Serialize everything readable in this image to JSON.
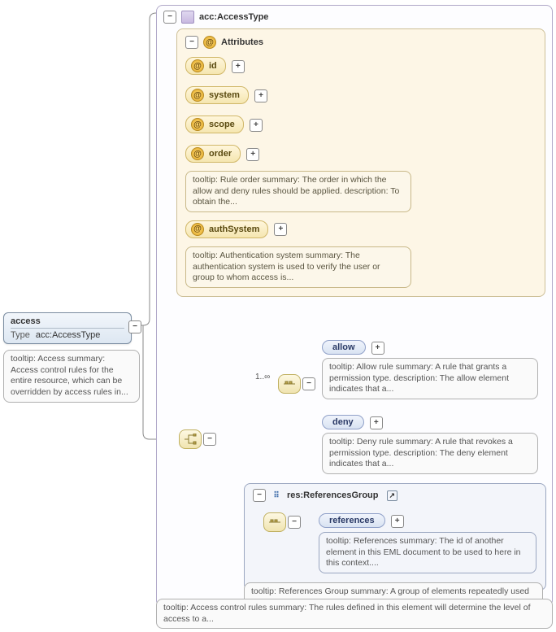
{
  "root": {
    "name": "access",
    "type_label": "Type",
    "type_value": "acc:AccessType",
    "tooltip": "tooltip: Access summary: Access control rules for the entire resource, which can be overridden by access rules in..."
  },
  "panel": {
    "title": "acc:AccessType",
    "tooltip": "tooltip: Access control rules summary: The rules defined in this element will determine the level of access to a..."
  },
  "attrs": {
    "header": "Attributes",
    "items": [
      {
        "name": "id"
      },
      {
        "name": "system"
      },
      {
        "name": "scope"
      },
      {
        "name": "order",
        "tooltip": "tooltip: Rule order summary: The order in which the allow and deny rules should be applied. description: To obtain the..."
      },
      {
        "name": "authSystem",
        "tooltip": "tooltip: Authentication system summary: The authentication system is used to verify the user or group to whom access is..."
      }
    ]
  },
  "choice": {
    "occ": "1..∞",
    "allow": {
      "label": "allow",
      "tooltip": "tooltip: Allow rule summary: A rule that grants a permission type. description: The allow element indicates that a..."
    },
    "deny": {
      "label": "deny",
      "tooltip": "tooltip: Deny rule summary: A rule that revokes a permission type. description: The deny element indicates that a..."
    }
  },
  "refgroup": {
    "title": "res:ReferencesGroup",
    "refs_label": "references",
    "refs_tooltip": "tooltip: References summary: The id of another element in this EML document to be used to here in this context....",
    "tooltip": "tooltip: References Group summary: A group of elements repeatedly used throughout EML to reference IDs. description: A..."
  }
}
